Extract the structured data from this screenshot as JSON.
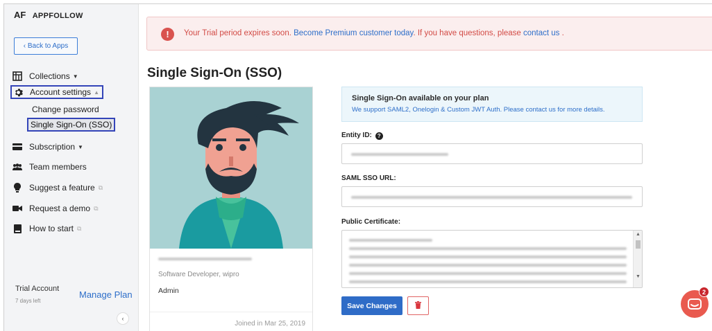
{
  "brand": {
    "logo": "AF",
    "name": "APPFOLLOW"
  },
  "sidebar": {
    "back_label": "‹ Back to Apps",
    "items": [
      {
        "label": "Collections",
        "icon": "collections-icon"
      },
      {
        "label": "Account settings",
        "icon": "gear-icon"
      },
      {
        "label": "Subscription",
        "icon": "credit-card-icon"
      },
      {
        "label": "Team members",
        "icon": "users-icon"
      },
      {
        "label": "Suggest a feature",
        "icon": "lightbulb-icon"
      },
      {
        "label": "Request a demo",
        "icon": "video-icon"
      },
      {
        "label": "How to start",
        "icon": "book-icon"
      }
    ],
    "sub_items": [
      "Change password",
      "Single Sign-On (SSO)"
    ],
    "trial_label": "Trial Account",
    "trial_days": "7 days left",
    "manage_label": "Manage Plan",
    "collapse_glyph": "‹"
  },
  "alert": {
    "text_start": "Your Trial period expires soon. ",
    "link1": "Become Premium customer today",
    "text_mid": ". If you have questions, please ",
    "link2": "contact us",
    "text_end": " .",
    "close": "×"
  },
  "page_title": "Single Sign-On (SSO)",
  "profile": {
    "role": "Software Developer, wipro",
    "access": "Admin",
    "joined": "Joined in Mar 25, 2019"
  },
  "plan": {
    "title": "Single Sign-On available on your plan",
    "text": "We support SAML2, Onelogin & Custom JWT Auth. Please contact us for more details."
  },
  "form": {
    "entity_label": "Entity ID:",
    "saml_label": "SAML SSO URL:",
    "cert_label": "Public Certificate:",
    "save_label": "Save Changes"
  },
  "chat": {
    "badge": "2"
  },
  "colors": {
    "accent": "#2f6cc7",
    "alert_text": "#d24a45",
    "chat": "#e95a4f",
    "highlight_border": "#3344b8"
  }
}
